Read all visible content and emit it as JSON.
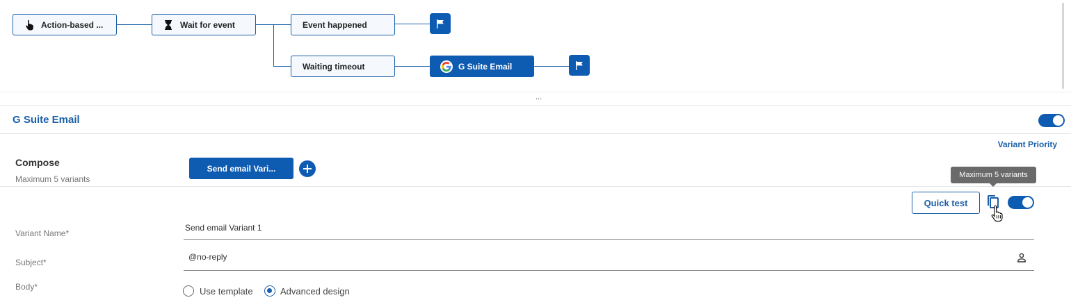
{
  "flow": {
    "nodes": [
      {
        "id": "action",
        "label": "Action-based ...",
        "icon": "hand-pointer-icon"
      },
      {
        "id": "wait",
        "label": "Wait for event",
        "icon": "hourglass-icon"
      },
      {
        "id": "happened",
        "label": "Event happened"
      },
      {
        "id": "timeout",
        "label": "Waiting timeout"
      },
      {
        "id": "gsuite",
        "label": "G Suite Email",
        "icon": "google-g-icon"
      }
    ],
    "end_icon": "flag-icon",
    "divider_label": "..."
  },
  "section": {
    "title": "G Suite Email",
    "enabled": true
  },
  "compose": {
    "variant_priority": "Variant Priority",
    "title": "Compose",
    "subtitle": "Maximum 5 variants",
    "variant_tab_label": "Send email Vari...",
    "add_icon": "plus-circle-icon"
  },
  "variant": {
    "tooltip": "Maximum 5 variants",
    "quick_test_label": "Quick test",
    "copy_icon": "copy-icon",
    "enabled": true,
    "fields": {
      "name_label": "Variant Name*",
      "name_value": "Send email Variant 1",
      "subject_label": "Subject*",
      "subject_value": "@no-reply",
      "body_label": "Body*"
    },
    "body_options": [
      {
        "label": "Use template",
        "selected": false
      },
      {
        "label": "Advanced design",
        "selected": true
      }
    ]
  },
  "colors": {
    "accent": "#0e5bb2",
    "node_border": "#1a5fa8",
    "tooltip_bg": "#6a6a6a"
  }
}
